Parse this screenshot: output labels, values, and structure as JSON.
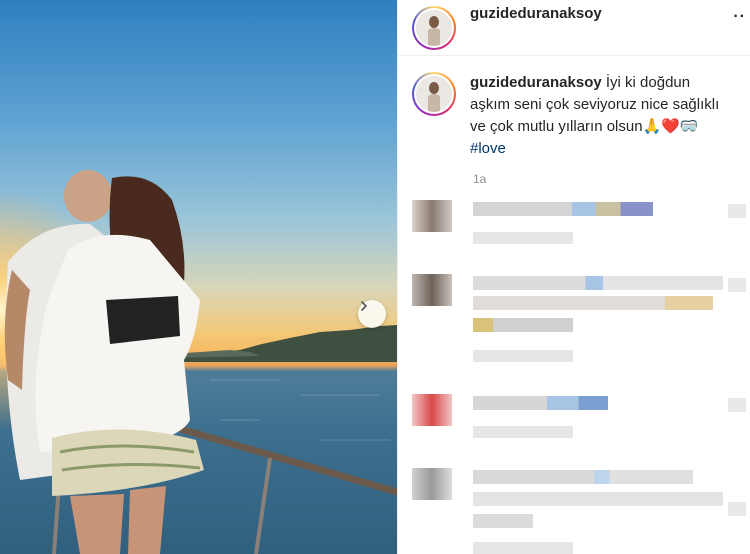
{
  "post": {
    "username": "guzideduranaksoy",
    "caption_username": "guzideduranaksoy",
    "caption_text": " İyi ki doğdun aşkım seni çok seviyoruz nice sağlıklı ve çok mutlu yılların olsun",
    "emojis": "🙏❤️🥽",
    "hashtag": "#love",
    "time_ago": "1a"
  },
  "icons": {
    "next": "chevron-right-icon",
    "more": "more-options-icon"
  },
  "colors": {
    "hashtag": "#00376b",
    "story_ring": "#d62976"
  }
}
